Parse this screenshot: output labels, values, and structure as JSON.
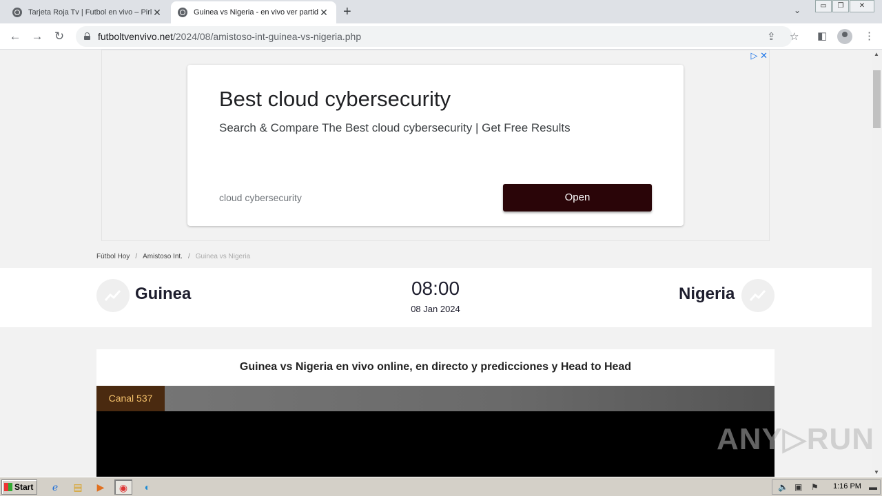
{
  "browser": {
    "tabs": [
      {
        "title": "Tarjeta Roja Tv | Futbol en vivo – Pirl",
        "close": "✕"
      },
      {
        "title": "Guinea vs Nigeria - en vivo ver partid",
        "close": "✕"
      }
    ],
    "new_tab": "+",
    "tab_menu": "⌄",
    "window_controls": [
      "▭",
      "❐",
      "✕"
    ],
    "url_host": "futboltvenvivo.net",
    "url_path": "/2024/08/amistoso-int-guinea-vs-nigeria.php"
  },
  "ad": {
    "title": "Best cloud cybersecurity",
    "subtitle": "Search & Compare The Best cloud cybersecurity | Get Free Results",
    "domain": "cloud cybersecurity",
    "cta": "Open",
    "choices": "▷ ✕"
  },
  "breadcrumb": {
    "items": [
      "Fútbol Hoy",
      "Amistoso Int.",
      "Guinea vs Nigeria"
    ],
    "separator": "/"
  },
  "match": {
    "home": "Guinea",
    "away": "Nigeria",
    "time": "08:00",
    "date": "08 Jan 2024"
  },
  "panel": {
    "title": "Guinea vs Nigeria en vivo online, en directo y predicciones y Head to Head",
    "channel": "Canal 537"
  },
  "watermark": "ANY▷RUN",
  "taskbar": {
    "start": "Start",
    "clock": "1:16 PM"
  },
  "colors": {
    "ad_button": "#2a0508",
    "channel_tab_bg": "#4a2a10",
    "channel_tab_text": "#f5c26b"
  }
}
